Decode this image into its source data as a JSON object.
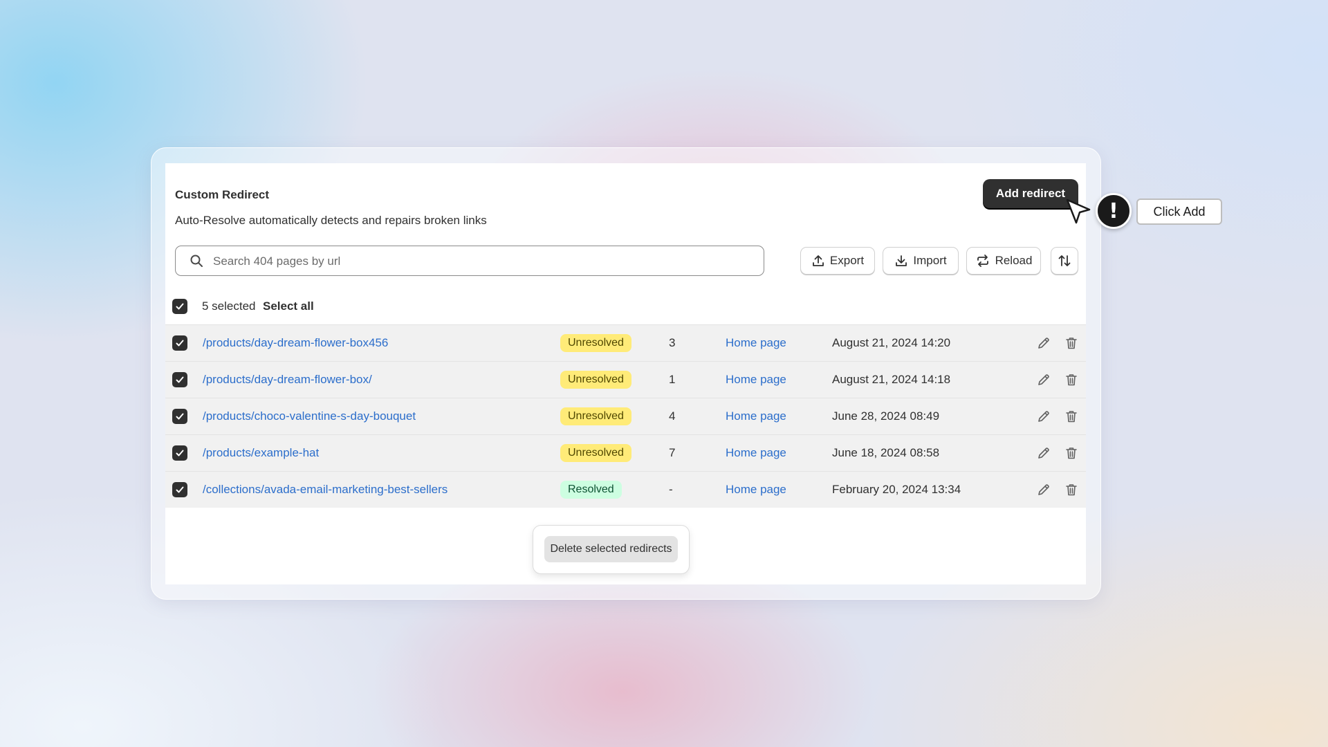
{
  "header": {
    "title": "Custom Redirect",
    "subtitle": "Auto-Resolve automatically detects and repairs broken links",
    "add_button": "Add redirect"
  },
  "search": {
    "placeholder": "Search 404 pages by url",
    "value": ""
  },
  "toolbar": {
    "export": "Export",
    "import": "Import",
    "reload": "Reload",
    "sort_icon": "sort-arrows-icon"
  },
  "selection": {
    "selected_text": "5 selected",
    "select_all": "Select all",
    "checked": true
  },
  "rows": [
    {
      "url": "/products/day-dream-flower-box456",
      "status": "Unresolved",
      "count": "3",
      "target": "Home page",
      "date": "August 21, 2024 14:20",
      "checked": true
    },
    {
      "url": "/products/day-dream-flower-box/",
      "status": "Unresolved",
      "count": "1",
      "target": "Home page",
      "date": "August 21, 2024 14:18",
      "checked": true
    },
    {
      "url": "/products/choco-valentine-s-day-bouquet",
      "status": "Unresolved",
      "count": "4",
      "target": "Home page",
      "date": "June 28, 2024 08:49",
      "checked": true
    },
    {
      "url": "/products/example-hat",
      "status": "Unresolved",
      "count": "7",
      "target": "Home page",
      "date": "June 18, 2024 08:58",
      "checked": true
    },
    {
      "url": "/collections/avada-email-marketing-best-sellers",
      "status": "Resolved",
      "count": "-",
      "target": "Home page",
      "date": "February 20, 2024 13:34",
      "checked": true
    }
  ],
  "bulk_actions": {
    "delete_label": "Delete selected redirects"
  },
  "hint": {
    "icon": "!",
    "label": "Click Add"
  },
  "colors": {
    "link": "#2c6ecb",
    "unresolved_badge": "#ffeb78",
    "resolved_badge": "#cdfee1",
    "primary_button": "#303030"
  }
}
